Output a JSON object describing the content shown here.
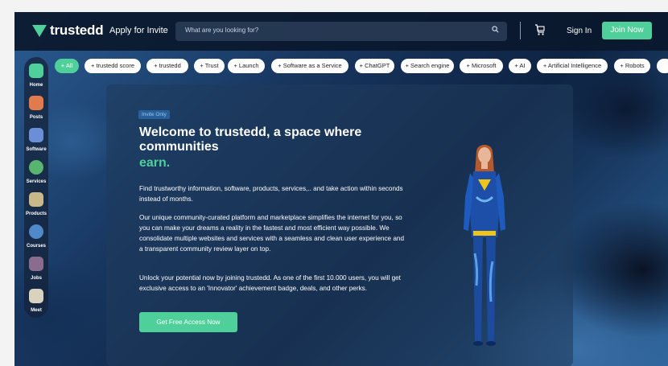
{
  "header": {
    "logo_text": "trustedd",
    "apply_label": "Apply for Invite",
    "search_placeholder": "What are you looking for?",
    "signin_label": "Sign In",
    "join_label": "Join Now"
  },
  "sidebar": {
    "items": [
      {
        "label": "Home",
        "icon": "home-icon",
        "color": "#4fd09a"
      },
      {
        "label": "Posts",
        "icon": "posts-icon",
        "color": "#e17a4c"
      },
      {
        "label": "Software",
        "icon": "software-icon",
        "color": "#6b8fd6"
      },
      {
        "label": "Services",
        "icon": "services-icon",
        "color": "#58b46f"
      },
      {
        "label": "Products",
        "icon": "products-icon",
        "color": "#c9b98a"
      },
      {
        "label": "Courses",
        "icon": "courses-icon",
        "color": "#4f89c8"
      },
      {
        "label": "Jobs",
        "icon": "jobs-icon",
        "color": "#8a6c8f"
      },
      {
        "label": "Meet",
        "icon": "meet-icon",
        "color": "#d8d2bf"
      }
    ]
  },
  "chips": [
    "+ All",
    "+ trustedd score",
    "+ trustedd",
    "+ Trust",
    "+ Launch",
    "+ Software as a Service",
    "+ ChatGPT",
    "+ Search engine",
    "+ Microsoft",
    "+ AI",
    "+ Artificial Intelligence",
    "+ Robots"
  ],
  "hero": {
    "badge": "Invite Only",
    "title": "Welcome to trustedd, a space where communities",
    "title_accent": "earn.",
    "para1": "Find trustworthy information, software, products, services,.. and take action within seconds instead of months.",
    "para2": "Our unique community-curated platform and marketplace simplifies the internet for you, so you can make your dreams a reality in the fastest and most efficient way possible. We consolidate multiple websites and services with a seamless and clean user experience and a transparent community review layer on top.",
    "para3": "Unlock your potential now by joining trustedd. As one of the first 10.000 users, you will get exclusive access to an 'Innovator' achievement badge, deals, and other perks.",
    "cta_label": "Get Free Access Now"
  },
  "colors": {
    "accent": "#4fd09a",
    "topbar": "#0a182c"
  }
}
